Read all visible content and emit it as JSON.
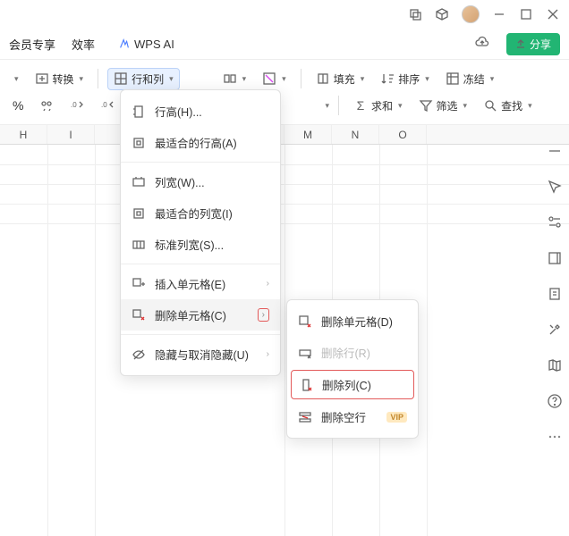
{
  "titlebar": {},
  "tabs": {
    "member": "会员专享",
    "efficiency": "效率",
    "wpsai": "WPS AI"
  },
  "share": {
    "label": "分享"
  },
  "ribbon": {
    "convert": "转换",
    "rowcol": "行和列",
    "fill": "填充",
    "sort": "排序",
    "freeze": "冻结",
    "sum": "求和",
    "filter": "筛选",
    "find": "查找",
    "pct": "%",
    "dec0": ".0",
    "inc": ".00",
    "dec": ".00"
  },
  "columns": [
    "H",
    "I",
    "",
    "",
    "",
    "",
    "M",
    "N",
    "O"
  ],
  "menu": {
    "rowheight": "行高(H)...",
    "bestfit_row": "最适合的行高(A)",
    "colwidth": "列宽(W)...",
    "bestfit_col": "最适合的列宽(I)",
    "std_colwidth": "标准列宽(S)...",
    "insert_cells": "插入单元格(E)",
    "delete_cells": "删除单元格(C)",
    "hide_unhide": "隐藏与取消隐藏(U)"
  },
  "submenu": {
    "delete_cells": "删除单元格(D)",
    "delete_row": "删除行(R)",
    "delete_col": "删除列(C)",
    "delete_blank": "删除空行",
    "vip": "VIP"
  }
}
